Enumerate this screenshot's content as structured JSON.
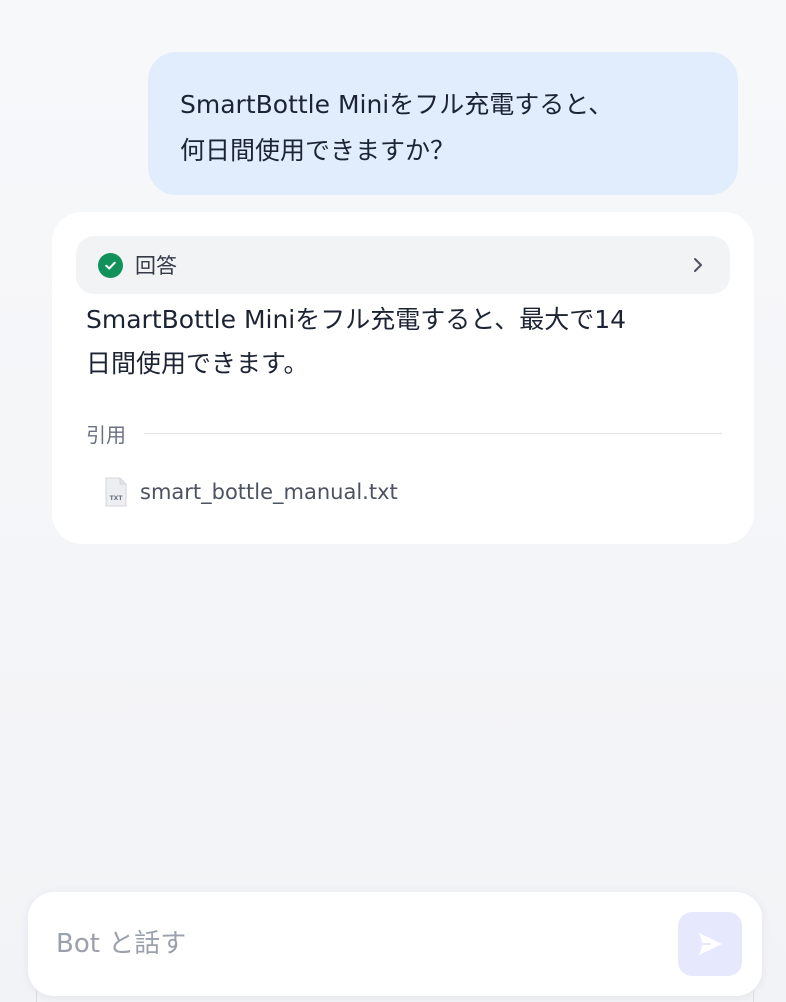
{
  "conversation": {
    "user_message": "SmartBottle Miniをフル充電すると、\n何日間使用できますか？",
    "answer": {
      "header_label": "回答",
      "status_icon": "check-circle-icon",
      "text": "SmartBottle Miniをフル充電すると、最大で14\n日間使用できます。",
      "citation_label": "引用",
      "citations": [
        {
          "file_name": "smart_bottle_manual.txt",
          "icon": "txt-file-icon",
          "icon_text": "TXT"
        }
      ]
    }
  },
  "composer": {
    "placeholder": "Bot と話す",
    "value": ""
  },
  "colors": {
    "user_bubble": "#e1edfd",
    "success": "#10925a",
    "send_button": "#e6e8fe"
  }
}
